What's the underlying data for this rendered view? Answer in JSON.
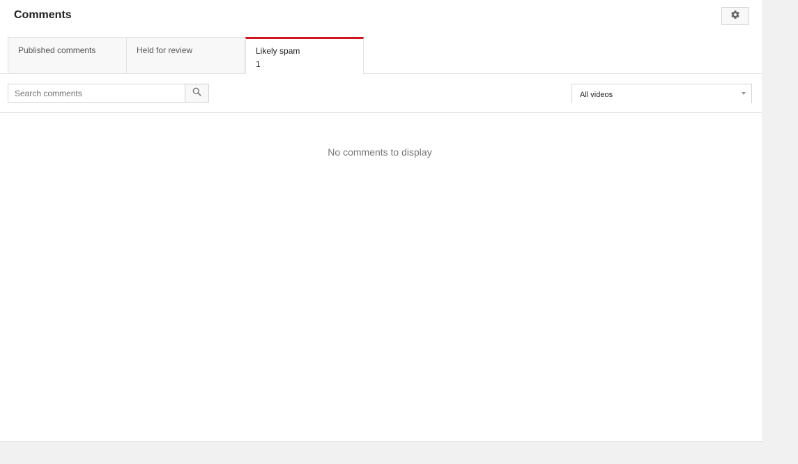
{
  "header": {
    "title": "Comments",
    "settings_icon": "gear-icon"
  },
  "tabs": [
    {
      "label": "Published comments",
      "count": "",
      "active": false
    },
    {
      "label": "Held for review",
      "count": "",
      "active": false
    },
    {
      "label": "Likely spam",
      "count": "1",
      "active": true
    }
  ],
  "search": {
    "value": "",
    "placeholder": "Search comments",
    "button_icon": "search-icon"
  },
  "filter": {
    "selected": "All videos",
    "icon": "dropdown-arrow-icon"
  },
  "content": {
    "empty_message": "No comments to display"
  },
  "colors": {
    "active_tab_accent": "#cc181e",
    "page_background": "#f1f1f1",
    "panel_background": "#ffffff"
  }
}
